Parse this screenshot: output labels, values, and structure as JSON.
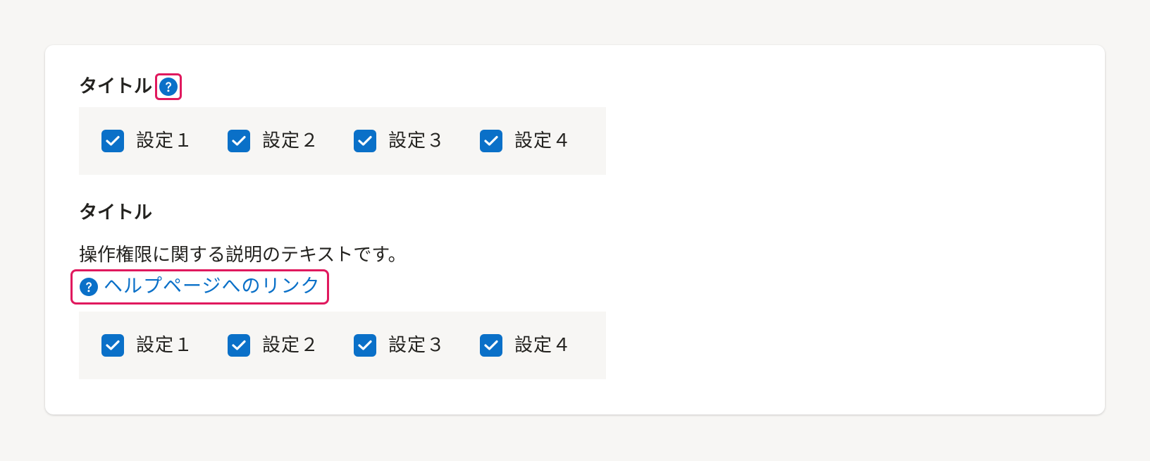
{
  "colors": {
    "accent": "#0a70c8",
    "highlight": "#e0195e",
    "background": "#f7f6f4",
    "card": "#ffffff"
  },
  "section1": {
    "title": "タイトル",
    "help_icon": "question-circle-icon",
    "checkboxes": [
      {
        "label": "設定１",
        "checked": true
      },
      {
        "label": "設定２",
        "checked": true
      },
      {
        "label": "設定３",
        "checked": true
      },
      {
        "label": "設定４",
        "checked": true
      }
    ]
  },
  "section2": {
    "title": "タイトル",
    "description": "操作権限に関する説明のテキストです。",
    "help_link": {
      "icon": "question-circle-icon",
      "label": "ヘルプページへのリンク"
    },
    "checkboxes": [
      {
        "label": "設定１",
        "checked": true
      },
      {
        "label": "設定２",
        "checked": true
      },
      {
        "label": "設定３",
        "checked": true
      },
      {
        "label": "設定４",
        "checked": true
      }
    ]
  }
}
